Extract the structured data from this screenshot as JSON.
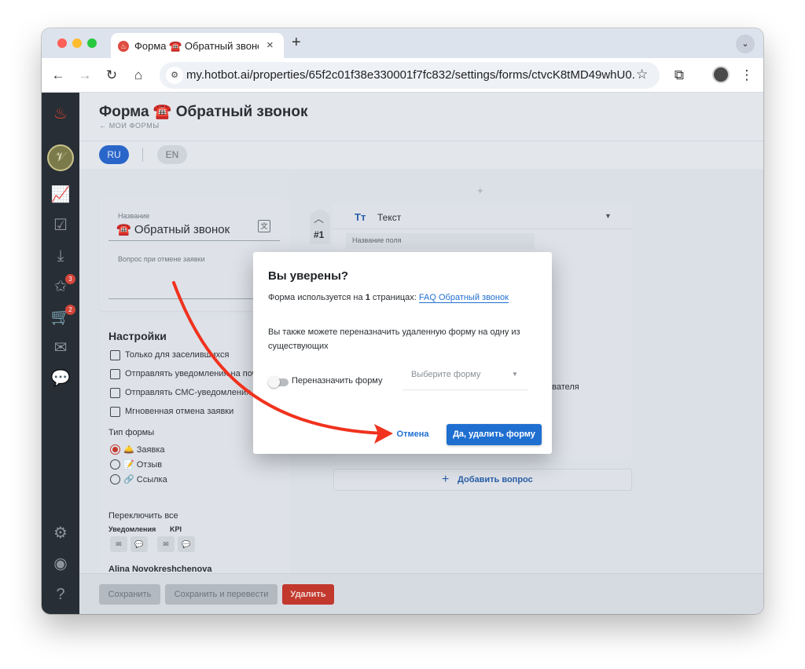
{
  "browser": {
    "tab_title": "Форма ☎️ Обратный звонок",
    "tab_close": "×",
    "new_tab": "+",
    "url": "my.hotbot.ai/properties/65f2c01f38e330001f7fc832/settings/forms/ctvcK8tMD49whU0..."
  },
  "header": {
    "title": "Форма ☎️ Обратный звонок",
    "back_link": "← МОИ ФОРМЫ",
    "lang_ru": "RU",
    "lang_en": "EN"
  },
  "name_card": {
    "name_label": "Название",
    "name_value": "☎️ Обратный звонок",
    "cancel_label": "Вопрос при отмене заявки"
  },
  "settings": {
    "title": "Настройки",
    "checkboxes": [
      {
        "label": "Только для заселившихся"
      },
      {
        "label": "Отправлять уведомления на почту"
      },
      {
        "label": "Отправлять СМС-уведомления"
      },
      {
        "label": "Мгновенная отмена заявки"
      }
    ],
    "form_type_label": "Тип формы",
    "form_types": [
      {
        "label": "🛎️ Заявка",
        "checked": true
      },
      {
        "label": "📝 Отзыв",
        "checked": false
      },
      {
        "label": "🔗 Ссылка",
        "checked": false
      }
    ],
    "toggle_all_label": "Переключить все",
    "notifications_label": "Уведомления",
    "kpi_label": "KPI",
    "user_name": "Alina Novokreshchenova"
  },
  "question": {
    "number": "#1",
    "type_icon": "Tт",
    "type": "Текст",
    "field_label": "Название поля",
    "partial_text": "ователя",
    "add_label": "Добавить вопрос",
    "top_plus": "+"
  },
  "sidebar": {
    "badges": {
      "reviews": "3",
      "orders": "2"
    }
  },
  "footer": {
    "save": "Сохранить",
    "save_translate": "Сохранить и перевести",
    "delete": "Удалить"
  },
  "dialog": {
    "title": "Вы уверены?",
    "usage_prefix": "Форма используется на ",
    "usage_count": "1",
    "usage_suffix": " страницах: ",
    "usage_link": "FAQ Обратный звонок",
    "reassign_text": "Вы также можете переназначить удаленную форму на одну из существующих",
    "toggle_label": "Переназначить форму",
    "select_placeholder": "Выберите форму",
    "cancel": "Отмена",
    "confirm": "Да, удалить форму"
  },
  "colors": {
    "accent_blue": "#1f6fd1",
    "danger_red": "#c2382d",
    "sidebar_bg": "#282e35",
    "annotation_arrow": "#f0321e"
  },
  "icons": {
    "sidebar": [
      "flame-icon",
      "logo-icon",
      "analytics-icon",
      "tasks-icon",
      "inbox-icon",
      "reviews-icon",
      "cart-icon",
      "mail-icon",
      "chat-icon",
      "settings-icon",
      "profile-icon",
      "help-icon"
    ]
  }
}
